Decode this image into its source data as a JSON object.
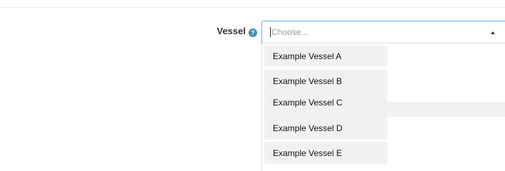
{
  "form": {
    "vessel_label": "Vessel",
    "help_glyph": "?",
    "help_icon": "question-circle-icon",
    "select": {
      "placeholder": "Choose...",
      "expanded": true,
      "arrow_icon": "caret-up-icon"
    },
    "options": [
      {
        "label": "Example Vessel A"
      },
      {
        "label": "Example Vessel B"
      },
      {
        "label": "Example Vessel C"
      },
      {
        "label": "Example Vessel D"
      },
      {
        "label": "Example Vessel E"
      }
    ]
  },
  "colors": {
    "focus_border": "#66afe9",
    "help_icon_bg": "#3c8dbc",
    "option_bg": "#f1f1f1",
    "placeholder_text": "#999999"
  }
}
